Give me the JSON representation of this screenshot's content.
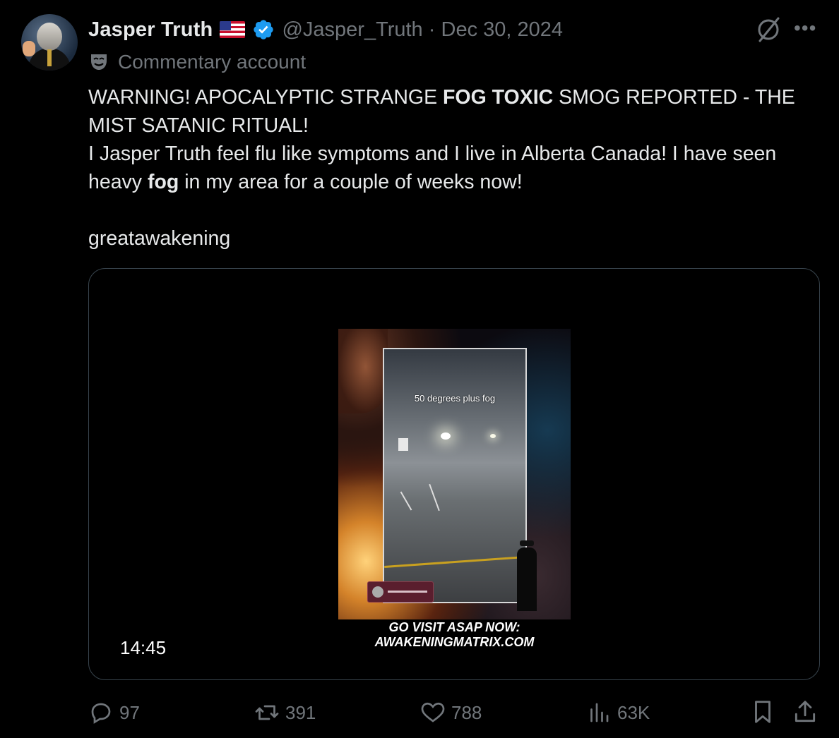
{
  "author": {
    "name": "Jasper Truth",
    "handle": "@Jasper_Truth",
    "separator": "·",
    "date": "Dec 30, 2024",
    "flag_icon": "us-flag-icon",
    "verified_icon": "verified-badge-icon"
  },
  "label": {
    "icon": "theater-mask-icon",
    "text": "Commentary account"
  },
  "tweet": {
    "line1_part1": "WARNING! APOCALYPTIC STRANGE ",
    "line1_bold": "FOG TOXIC",
    "line1_part2": " SMOG REPORTED - THE MIST SATANIC RITUAL!",
    "line2_part1": "I Jasper Truth feel flu like symptoms and I live in Alberta Canada!  I have seen heavy ",
    "line2_bold": "fog",
    "line2_part2": " in my area for a couple of weeks now!",
    "line3": "greatawakening"
  },
  "media": {
    "overlay_caption": "50 degrees plus fog",
    "promo_line1": "GO VISIT ASAP NOW:",
    "promo_line2": "AWAKENINGMATRIX.COM",
    "duration": "14:45"
  },
  "actions": {
    "replies": "97",
    "reposts": "391",
    "likes": "788",
    "views": "63K"
  },
  "colors": {
    "background": "#000000",
    "text": "#e7e9ea",
    "muted": "#71767b",
    "verified": "#1d9bf0",
    "border": "#38444d"
  }
}
